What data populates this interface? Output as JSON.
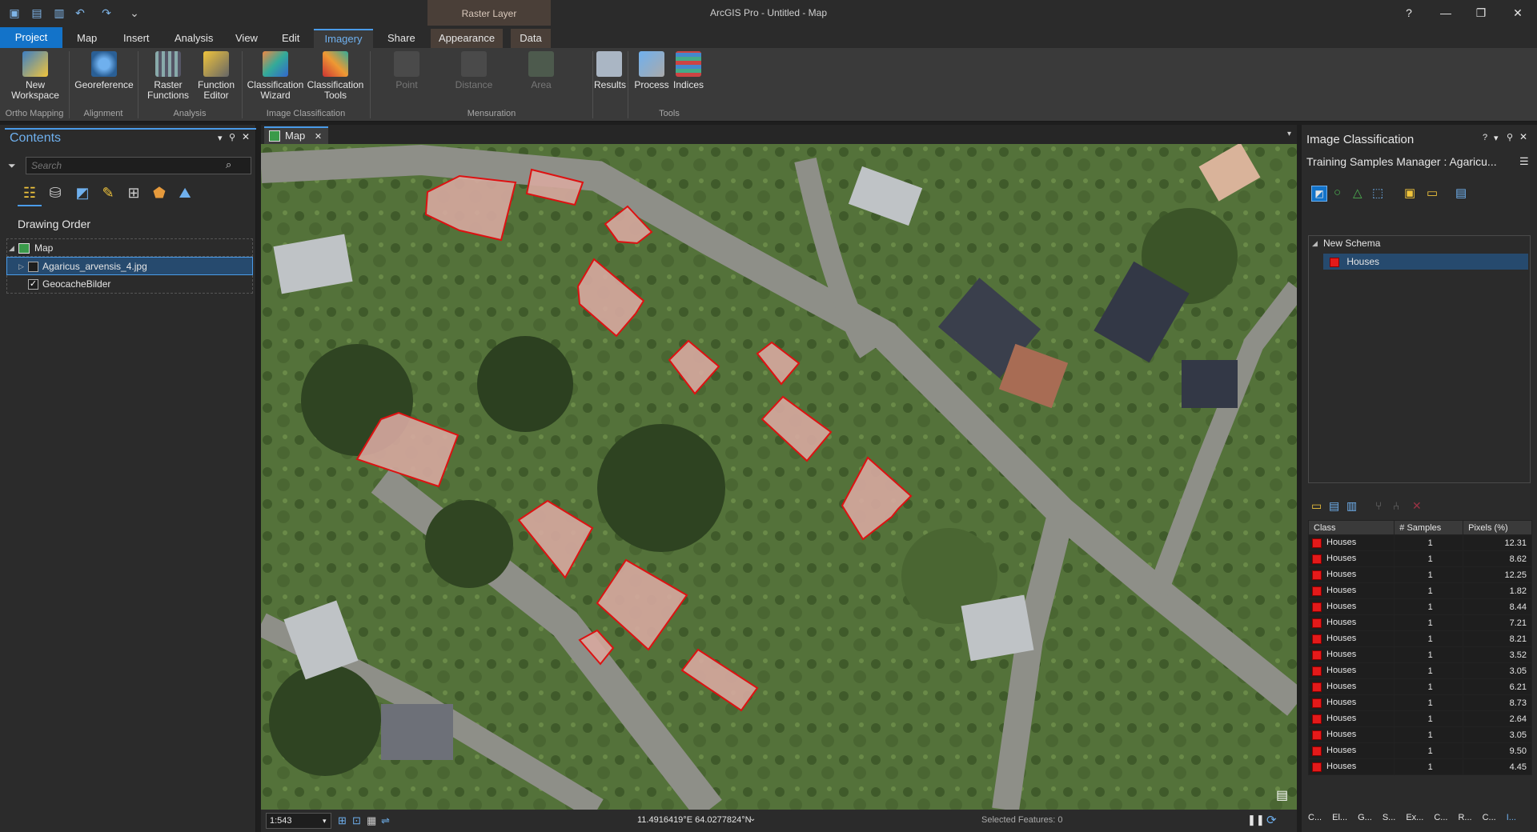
{
  "app": {
    "title": "ArcGIS Pro - Untitled - Map",
    "contextual_tab_group": "Raster Layer"
  },
  "window_buttons": {
    "help": "?",
    "minimize": "—",
    "restore": "❐",
    "close": "✕"
  },
  "tabs": [
    {
      "label": "Project"
    },
    {
      "label": "Map"
    },
    {
      "label": "Insert"
    },
    {
      "label": "Analysis"
    },
    {
      "label": "View"
    },
    {
      "label": "Edit"
    },
    {
      "label": "Imagery"
    },
    {
      "label": "Share"
    },
    {
      "label": "Appearance"
    },
    {
      "label": "Data"
    }
  ],
  "active_tab": "Imagery",
  "ribbon": {
    "new_workspace": "New\nWorkspace",
    "georeference": "Georeference",
    "raster_functions": "Raster\nFunctions",
    "function_editor": "Function\nEditor",
    "classification_wizard": "Classification\nWizard",
    "classification_tools": "Classification\nTools",
    "point": "Point",
    "distance": "Distance",
    "area": "Area",
    "results": "Results",
    "process": "Process",
    "indices": "Indices",
    "groups": {
      "ortho_mapping": "Ortho Mapping",
      "alignment": "Alignment",
      "analysis": "Analysis",
      "image_classification": "Image Classification",
      "mensuration": "Mensuration",
      "tools": "Tools"
    }
  },
  "contents": {
    "title": "Contents",
    "search_placeholder": "Search",
    "drawing_order": "Drawing Order",
    "map_name": "Map",
    "layers": [
      {
        "name": "Agaricus_arvensis_4.jpg",
        "checked": false,
        "selected": true
      },
      {
        "name": "GeocacheBilder",
        "checked": true,
        "selected": false
      }
    ]
  },
  "map": {
    "tab_label": "Map",
    "scale": "1:543",
    "coordinates": "11.4916419°E 64.0277824°N",
    "selected_features": "Selected Features: 0"
  },
  "image_classification": {
    "title": "Image Classification",
    "subtitle": "Training Samples Manager : Agaricu...",
    "schema_name": "New Schema",
    "schema_class": "Houses",
    "class_color": "#e31a1a",
    "table_headers": {
      "class": "Class",
      "samples": "# Samples",
      "pixels": "Pixels (%)"
    },
    "rows": [
      {
        "class": "Houses",
        "samples": "1",
        "pixels": "12.31"
      },
      {
        "class": "Houses",
        "samples": "1",
        "pixels": "8.62"
      },
      {
        "class": "Houses",
        "samples": "1",
        "pixels": "12.25"
      },
      {
        "class": "Houses",
        "samples": "1",
        "pixels": "1.82"
      },
      {
        "class": "Houses",
        "samples": "1",
        "pixels": "8.44"
      },
      {
        "class": "Houses",
        "samples": "1",
        "pixels": "7.21"
      },
      {
        "class": "Houses",
        "samples": "1",
        "pixels": "8.21"
      },
      {
        "class": "Houses",
        "samples": "1",
        "pixels": "3.52"
      },
      {
        "class": "Houses",
        "samples": "1",
        "pixels": "3.05"
      },
      {
        "class": "Houses",
        "samples": "1",
        "pixels": "6.21"
      },
      {
        "class": "Houses",
        "samples": "1",
        "pixels": "8.73"
      },
      {
        "class": "Houses",
        "samples": "1",
        "pixels": "2.64"
      },
      {
        "class": "Houses",
        "samples": "1",
        "pixels": "3.05"
      },
      {
        "class": "Houses",
        "samples": "1",
        "pixels": "9.50"
      },
      {
        "class": "Houses",
        "samples": "1",
        "pixels": "4.45"
      }
    ],
    "bottom_tabs": [
      "C...",
      "El...",
      "G...",
      "S...",
      "Ex...",
      "C...",
      "R...",
      "C...",
      "I..."
    ]
  }
}
